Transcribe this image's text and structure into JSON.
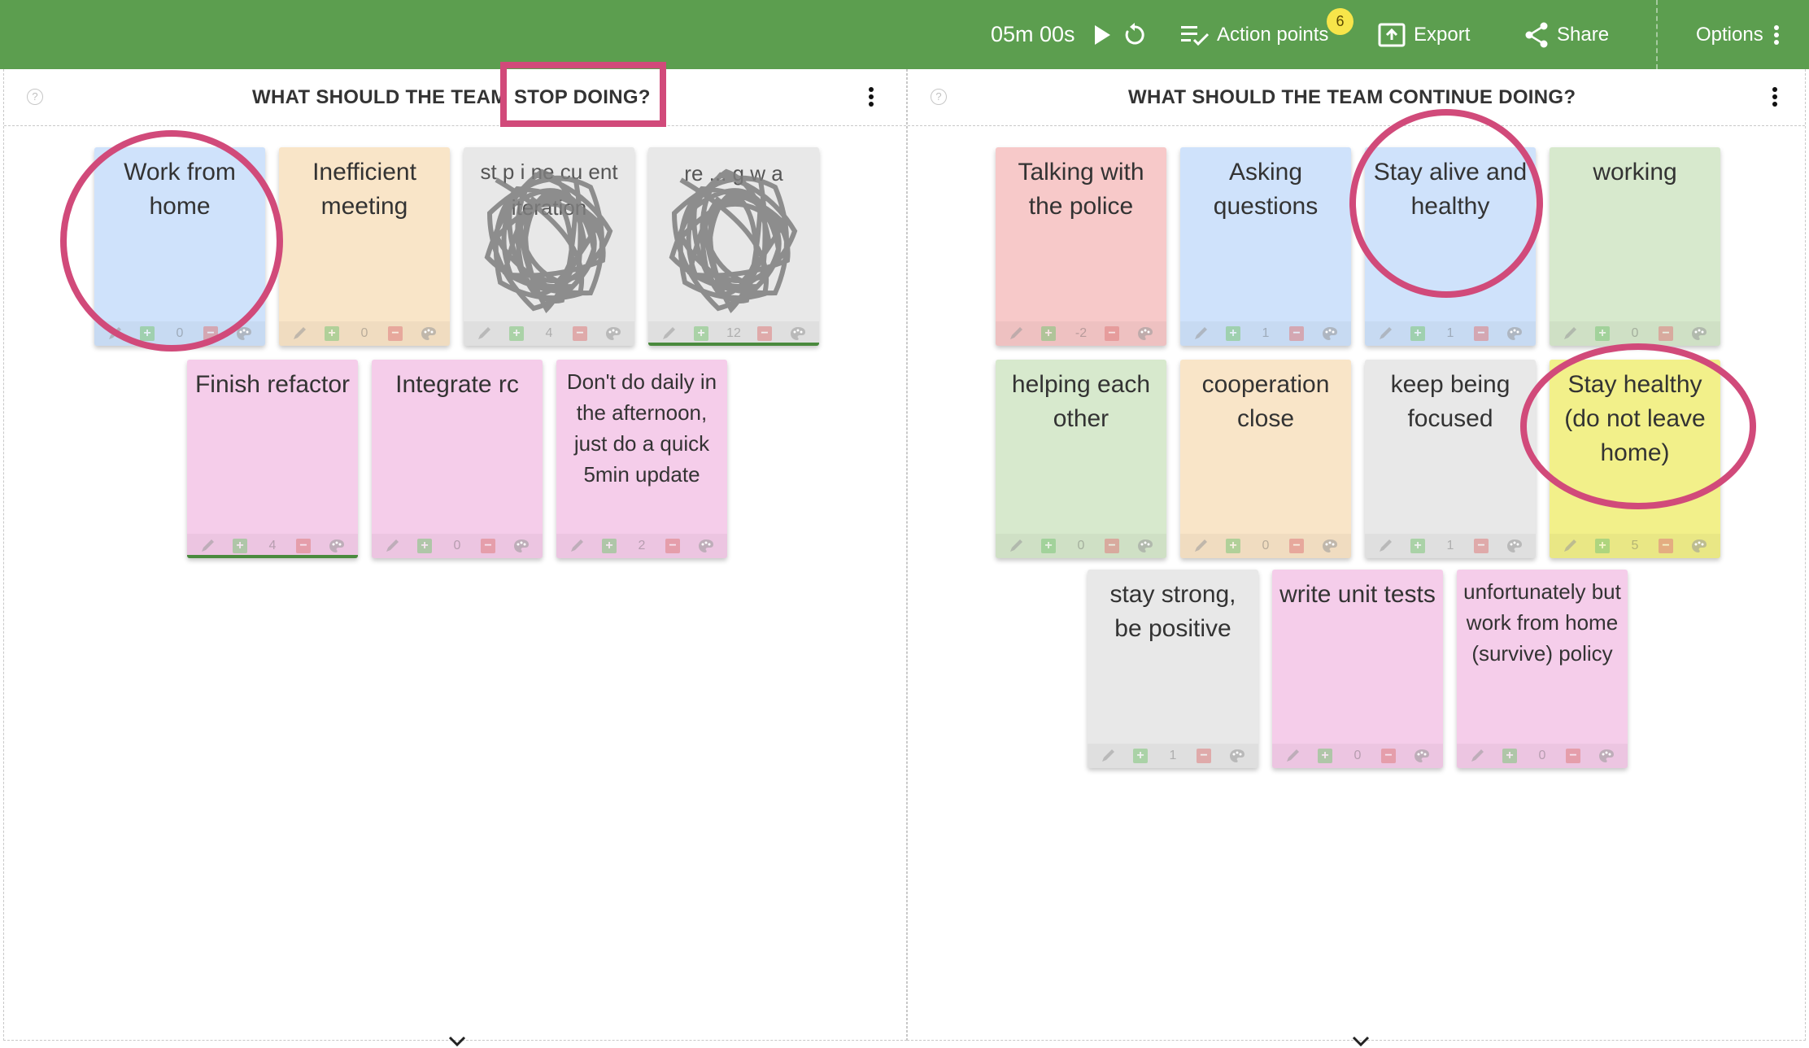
{
  "topbar": {
    "timer": "05m 00s",
    "action_points_label": "Action points",
    "action_points_badge": "6",
    "export_label": "Export",
    "share_label": "Share",
    "options_label": "Options",
    "color": "#5c9e4f"
  },
  "columns": [
    {
      "title_part1": "WHAT SHOULD THE TEAM",
      "title_part2": "STOP DOING?",
      "cards": [
        {
          "text": "Work from home",
          "color": "blue",
          "votes": "0",
          "highlighted": false
        },
        {
          "text": "Inefficient meeting",
          "color": "peach",
          "votes": "0",
          "highlighted": false
        },
        {
          "text": "stop ... current iteration (scribbled out)",
          "visible_text": [
            "st p",
            "i",
            "ne",
            "cu ent iteration"
          ],
          "color": "grey",
          "votes": "4",
          "highlighted": false
        },
        {
          "text": "re...g w... (scribbled out)",
          "visible_text": [
            "re ... g",
            "w",
            "a"
          ],
          "color": "grey",
          "votes": "12",
          "highlighted": true
        },
        {
          "text": "Finish refactor",
          "color": "pink",
          "votes": "4",
          "highlighted": true
        },
        {
          "text": "Integrate rc",
          "color": "pink",
          "votes": "0",
          "highlighted": false
        },
        {
          "text": "Don't do daily in the afternoon, just do a quick 5min update",
          "color": "pink",
          "votes": "2",
          "highlighted": false
        }
      ]
    },
    {
      "title": "WHAT SHOULD THE TEAM CONTINUE DOING?",
      "cards": [
        {
          "text": "Talking with the police",
          "color": "red",
          "votes": "-2"
        },
        {
          "text": "Asking questions",
          "color": "blue",
          "votes": "1"
        },
        {
          "text": "Stay alive and healthy",
          "color": "blue",
          "votes": "1"
        },
        {
          "text": "working",
          "color": "green",
          "votes": "0"
        },
        {
          "text": "helping each other",
          "color": "green",
          "votes": "0"
        },
        {
          "text": "cooperation close",
          "color": "peach",
          "votes": "0"
        },
        {
          "text": "keep being focused",
          "color": "grey",
          "votes": "1"
        },
        {
          "text": "Stay healthy (do not leave home)",
          "color": "yellow",
          "votes": "5"
        },
        {
          "text": "stay strong, be positive",
          "color": "grey",
          "votes": "1"
        },
        {
          "text": "write unit tests",
          "color": "pink",
          "votes": "0"
        },
        {
          "text": "unfortunately but work from home (survive) policy",
          "color": "pink",
          "votes": "0"
        }
      ]
    }
  ],
  "annotation_color": "#d14a7a"
}
